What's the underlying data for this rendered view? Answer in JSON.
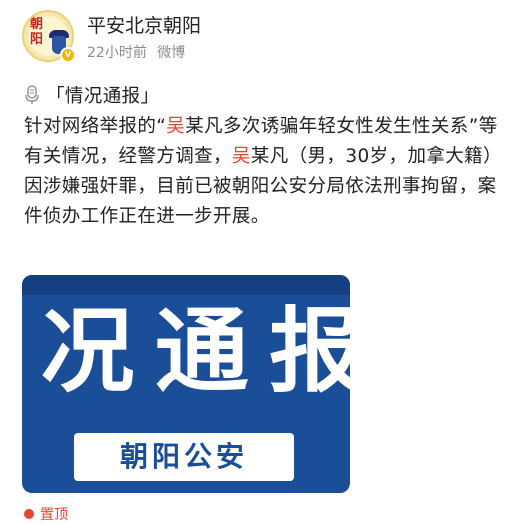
{
  "post": {
    "account_name": "平安北京朝阳",
    "avatar_text_line1": "朝",
    "avatar_text_line2": "阳",
    "verified_mark": "v",
    "time": "22小时前",
    "source": "微博",
    "icon": "microphone-icon",
    "content_segments": [
      {
        "text": "「情况通报」",
        "highlight": false
      },
      {
        "text": "针对网络举报的“",
        "highlight": false
      },
      {
        "text": "吴",
        "highlight": true
      },
      {
        "text": "某凡多次诱骗年轻女性发生性关系”等有关情况，经警方调查，",
        "highlight": false
      },
      {
        "text": "吴",
        "highlight": true
      },
      {
        "text": "某凡（男，30岁，加拿大籍）因涉嫌强奸罪，目前已被朝阳公安分局依法刑事拘留，案件侦办工作正在进一步开展。",
        "highlight": false
      }
    ],
    "highlight_color": "#e5462f"
  },
  "banner": {
    "big_text": "况通报",
    "label": "朝阳公安",
    "background_color": "#1a4e99"
  },
  "footer": {
    "partial_text": "置顶"
  }
}
